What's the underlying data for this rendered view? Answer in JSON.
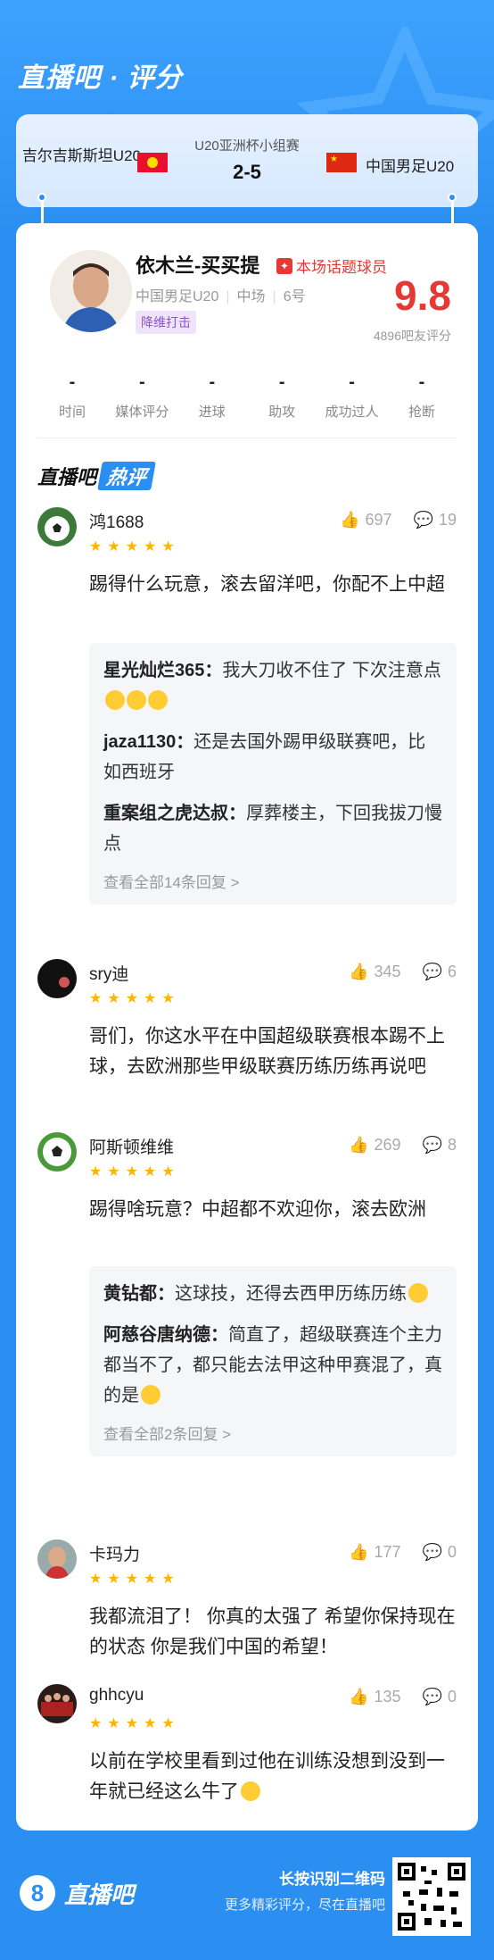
{
  "brand": {
    "title": "直播吧 · 评分"
  },
  "match": {
    "left_team": "吉尔吉斯斯坦U20",
    "competition": "U20亚洲杯小组赛",
    "score": "2-5",
    "right_team": "中国男足U20"
  },
  "player": {
    "name": "依木兰-买买提",
    "badge": "本场话题球员",
    "team": "中国男足U20",
    "position": "中场",
    "number": "6号",
    "tag": "降维打击",
    "rating": "9.8",
    "rating_count": "4896吧友评分"
  },
  "stats": [
    {
      "value": "-",
      "label": "时间"
    },
    {
      "value": "-",
      "label": "媒体评分"
    },
    {
      "value": "-",
      "label": "进球"
    },
    {
      "value": "-",
      "label": "助攻"
    },
    {
      "value": "-",
      "label": "成功过人"
    },
    {
      "value": "-",
      "label": "抢断"
    }
  ],
  "hot": {
    "prefix": "直播吧",
    "label": "热评"
  },
  "comments": [
    {
      "user": "鸿1688",
      "stars": "★★★★★",
      "likes": "697",
      "replies_count": "19",
      "text": "踢得什么玩意，滚去留洋吧，你配不上中超",
      "replies": [
        {
          "name": "星光灿烂365：",
          "text": "我大刀收不住了 下次注意点"
        },
        {
          "name": "jaza1130：",
          "text": "还是去国外踢甲级联赛吧，比如西班牙"
        },
        {
          "name": "重案组之虎达叔：",
          "text": "厚葬楼主，下回我拔刀慢点"
        }
      ],
      "more": "查看全部14条回复 >"
    },
    {
      "user": "sry迪",
      "stars": "★★★★★",
      "likes": "345",
      "replies_count": "6",
      "text": "哥们，你这水平在中国超级联赛根本踢不上球，去欧洲那些甲级联赛历练历练再说吧"
    },
    {
      "user": "阿斯顿维维",
      "stars": "★★★★★",
      "likes": "269",
      "replies_count": "8",
      "text": "踢得啥玩意？中超都不欢迎你，滚去欧洲",
      "replies": [
        {
          "name": "黄钻都：",
          "text": "这球技，还得去西甲历练历练"
        },
        {
          "name": "阿慈谷唐纳德：",
          "text": "简直了，超级联赛连个主力都当不了，都只能去法甲这种甲赛混了，真的是"
        }
      ],
      "more": "查看全部2条回复 >"
    },
    {
      "user": "卡玛力",
      "stars": "★★★★★",
      "likes": "177",
      "replies_count": "0",
      "text": "我都流泪了！ 你真的太强了 希望你保持现在的状态 你是我们中国的希望！"
    },
    {
      "user": "ghhcyu",
      "stars": "★★★★★",
      "likes": "135",
      "replies_count": "0",
      "text": "以前在学校里看到过他在训练没想到没到一年就已经这么牛了"
    }
  ],
  "footer": {
    "logo_num": "8",
    "brand": "直播吧",
    "line1": "长按识别二维码",
    "line2": "更多精彩评分，尽在直播吧"
  },
  "colors": {
    "primary": "#2a8ff0",
    "rating": "#e53935",
    "star": "#ffb400",
    "tag_purple": "#8a55c8"
  }
}
